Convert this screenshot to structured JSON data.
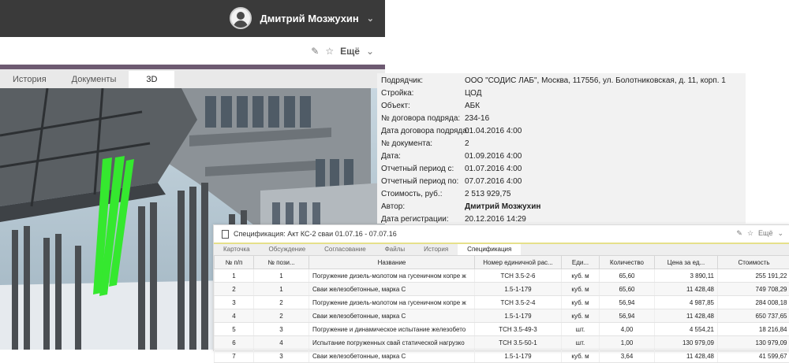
{
  "user": {
    "name": "Дмитрий Мозжухин"
  },
  "toolbar": {
    "more_label": "Ещё"
  },
  "tabs": [
    "История",
    "Документы",
    "3D"
  ],
  "info": [
    {
      "label": "Подрядчик:",
      "value": "ООО \"СОДИС ЛАБ\", Москва, 117556, ул. Болотниковская, д. 11, корп. 1"
    },
    {
      "label": "Стройка:",
      "value": "ЦОД"
    },
    {
      "label": "Объект:",
      "value": "АБК"
    },
    {
      "label": "№ договора подряда:",
      "value": "234-16"
    },
    {
      "label": "Дата договора подряда:",
      "value": "01.04.2016 4:00"
    },
    {
      "label": "№ документа:",
      "value": "2"
    },
    {
      "label": "Дата:",
      "value": "01.09.2016 4:00"
    },
    {
      "label": "Отчетный период с:",
      "value": "01.07.2016 4:00"
    },
    {
      "label": "Отчетный период по:",
      "value": "07.07.2016 4:00"
    },
    {
      "label": "Стоимость, руб.:",
      "value": "2 513 929,75"
    },
    {
      "label": "Автор:",
      "value": "Дмитрий Мозжухин"
    },
    {
      "label": "Дата регистрации:",
      "value": "20.12.2016 14:29"
    }
  ],
  "spec": {
    "title": "Спецификация: Акт КС-2 сваи 01.07.16 - 07.07.16",
    "more_label": "Ещё",
    "tabs": [
      "Карточка",
      "Обсуждение",
      "Согласование",
      "Файлы",
      "История",
      "Спецификация"
    ],
    "columns": [
      "№ п/п",
      "№ пози...",
      "Название",
      "Номер единичной рас...",
      "Еди...",
      "Количество",
      "Цена за ед...",
      "Стоимость"
    ],
    "rows": [
      [
        "1",
        "1",
        "Погружение дизель-молотом на гусеничном копре ж",
        "ТСН 3.5-2-6",
        "куб. м",
        "65,60",
        "3 890,11",
        "255 191,22"
      ],
      [
        "2",
        "1",
        "Сваи железобетонные, марка С",
        "1.5-1-179",
        "куб. м",
        "65,60",
        "11 428,48",
        "749 708,29"
      ],
      [
        "3",
        "2",
        "Погружение дизель-молотом на гусеничном копре ж",
        "ТСН 3.5-2-4",
        "куб. м",
        "56,94",
        "4 987,85",
        "284 008,18"
      ],
      [
        "4",
        "2",
        "Сваи железобетонные, марка С",
        "1.5-1-179",
        "куб. м",
        "56,94",
        "11 428,48",
        "650 737,65"
      ],
      [
        "5",
        "3",
        "Погружение и динамическое испытание железобето",
        "ТСН 3.5-49-3",
        "шт.",
        "4,00",
        "4 554,21",
        "18 216,84"
      ],
      [
        "6",
        "4",
        "Испытание погруженных свай статической нагрузко",
        "ТСН 3.5-50-1",
        "шт.",
        "1,00",
        "130 979,09",
        "130 979,09"
      ],
      [
        "7",
        "3",
        "Сваи железобетонные, марка С",
        "1.5-1-179",
        "куб. м",
        "3,64",
        "11 428,48",
        "41 599,67"
      ]
    ]
  }
}
